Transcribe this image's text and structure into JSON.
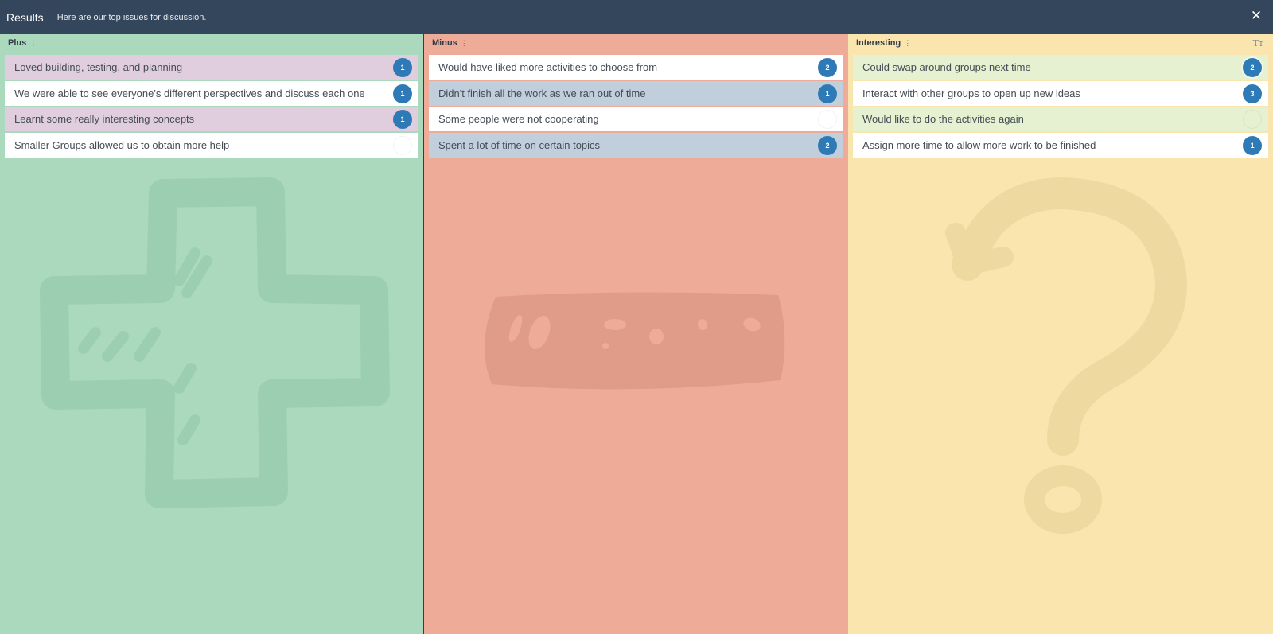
{
  "header": {
    "title": "Results",
    "subtitle": "Here are our top issues for discussion.",
    "close_icon": "close-icon"
  },
  "columns": [
    {
      "title": "Plus",
      "watermark_icon": "plus-sign-icon",
      "cards": [
        {
          "text": "Loved building, testing, and planning",
          "votes": "1",
          "color": "#e0cedf"
        },
        {
          "text": "We were able to see everyone's different perspectives and discuss each one",
          "votes": "1",
          "color": "#ffffff"
        },
        {
          "text": "Learnt some really interesting concepts",
          "votes": "1",
          "color": "#e0cedf"
        },
        {
          "text": "Smaller Groups allowed us to obtain more help",
          "votes": "",
          "color": "#ffffff"
        }
      ]
    },
    {
      "title": "Minus",
      "watermark_icon": "minus-sign-icon",
      "cards": [
        {
          "text": "Would have liked more activities to choose from",
          "votes": "2",
          "color": "#ffffff"
        },
        {
          "text": "Didn't finish all the work as we ran out of time",
          "votes": "1",
          "color": "#c1cedc"
        },
        {
          "text": "Some people were not cooperating",
          "votes": "",
          "color": "#ffffff"
        },
        {
          "text": "Spent a lot of time on certain topics",
          "votes": "2",
          "color": "#c1cedc"
        }
      ]
    },
    {
      "title": "Interesting",
      "watermark_icon": "question-mark-icon",
      "font_toggle": "Tт",
      "cards": [
        {
          "text": "Could swap around groups next time",
          "votes": "2",
          "color": "#e5f1d0"
        },
        {
          "text": "Interact with other groups to open up new ideas",
          "votes": "3",
          "color": "#ffffff"
        },
        {
          "text": "Would like to do the activities again",
          "votes": "",
          "color": "#e5f1d0"
        },
        {
          "text": "Assign more time to allow more work to be finished",
          "votes": "1",
          "color": "#ffffff"
        }
      ]
    }
  ],
  "colors": {
    "topbar": "#34465b",
    "plus_bg": "#abd9bd",
    "minus_bg": "#eeab97",
    "interesting_bg": "#fbe5ae",
    "vote_badge": "#2d7ab7"
  }
}
